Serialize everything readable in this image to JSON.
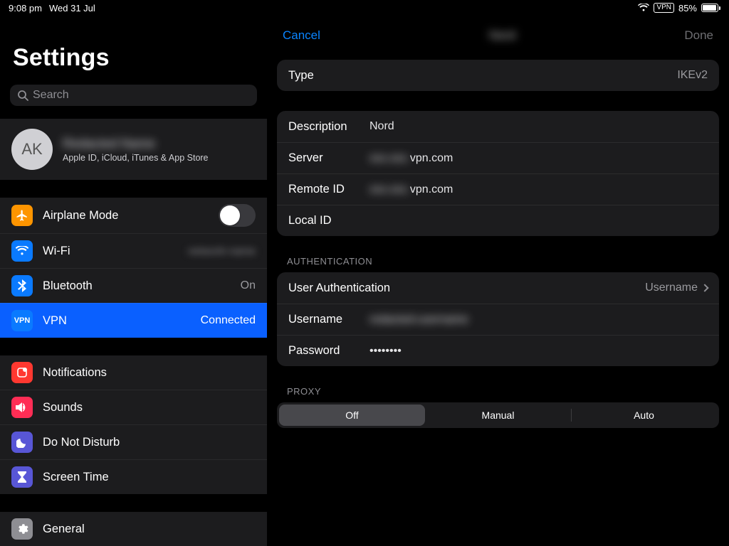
{
  "status": {
    "time": "9:08 pm",
    "date": "Wed 31 Jul",
    "vpn_badge": "VPN",
    "battery_pct": "85%"
  },
  "sidebar": {
    "title": "Settings",
    "search_placeholder": "Search",
    "account": {
      "initials": "AK",
      "name_redacted": "Redacted Name",
      "subtitle": "Apple ID, iCloud, iTunes & App Store"
    },
    "items_a": [
      {
        "key": "airplane",
        "label": "Airplane Mode",
        "icon": "airplane-icon",
        "color": "#fe9500"
      },
      {
        "key": "wifi",
        "label": "Wi-Fi",
        "icon": "wifi-icon",
        "color": "#0a7aff",
        "value_redacted": "network-name"
      },
      {
        "key": "bluetooth",
        "label": "Bluetooth",
        "icon": "bluetooth-icon",
        "color": "#0a7aff",
        "value": "On"
      },
      {
        "key": "vpn",
        "label": "VPN",
        "icon": "vpn-icon",
        "color": "#0a7aff",
        "value": "Connected",
        "selected": true
      }
    ],
    "items_b": [
      {
        "key": "notifications",
        "label": "Notifications",
        "icon": "notifications-icon",
        "color": "#ff3830"
      },
      {
        "key": "sounds",
        "label": "Sounds",
        "icon": "sounds-icon",
        "color": "#ff2d55"
      },
      {
        "key": "dnd",
        "label": "Do Not Disturb",
        "icon": "moon-icon",
        "color": "#5856d6"
      },
      {
        "key": "screentime",
        "label": "Screen Time",
        "icon": "hourglass-icon",
        "color": "#5856d6"
      }
    ],
    "items_c": [
      {
        "key": "general",
        "label": "General",
        "icon": "gear-icon",
        "color": "#8e8e93"
      }
    ]
  },
  "detail": {
    "cancel": "Cancel",
    "done": "Done",
    "title_redacted": "Nord",
    "type": {
      "label": "Type",
      "value": "IKEv2"
    },
    "config": {
      "description": {
        "label": "Description",
        "value": "Nord"
      },
      "server": {
        "label": "Server",
        "value_prefix_redacted": "xxx.xxx.",
        "value_suffix": "vpn.com"
      },
      "remote_id": {
        "label": "Remote ID",
        "value_prefix_redacted": "xxx.xxx.",
        "value_suffix": "vpn.com"
      },
      "local_id": {
        "label": "Local ID",
        "value": ""
      }
    },
    "auth_section": "AUTHENTICATION",
    "auth": {
      "user_auth": {
        "label": "User Authentication",
        "value": "Username"
      },
      "username": {
        "label": "Username",
        "value_redacted": "redacted-username"
      },
      "password": {
        "label": "Password",
        "mask": "••••••••"
      }
    },
    "proxy_section": "PROXY",
    "proxy": {
      "off": "Off",
      "manual": "Manual",
      "auto": "Auto",
      "selected": "off"
    }
  }
}
